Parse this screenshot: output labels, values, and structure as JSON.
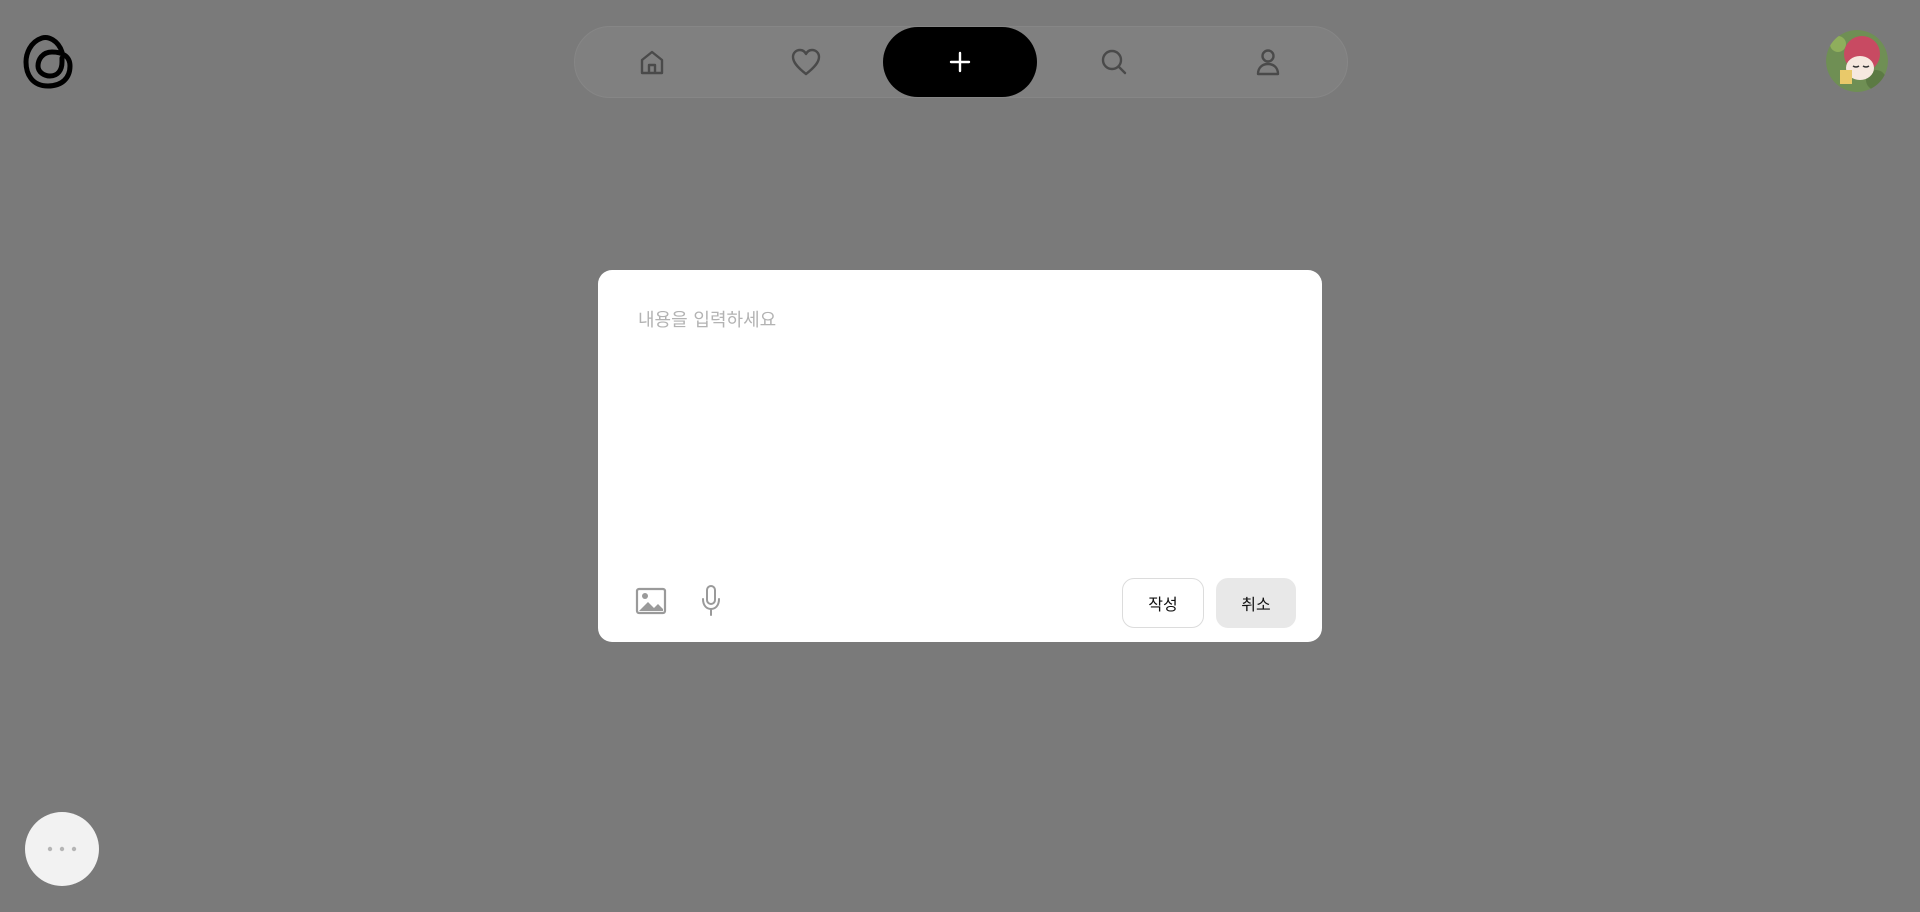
{
  "header": {
    "logo_icon": "threads-logo-icon",
    "nav": [
      {
        "id": "home",
        "icon": "home-icon"
      },
      {
        "id": "activity",
        "icon": "heart-icon"
      },
      {
        "id": "create",
        "icon": "plus-icon"
      },
      {
        "id": "search",
        "icon": "search-icon"
      },
      {
        "id": "profile",
        "icon": "person-icon"
      }
    ],
    "avatar_icon": "avatar"
  },
  "modal": {
    "placeholder": "내용을 입력하세요",
    "value": "",
    "tools": [
      "image-icon",
      "microphone-icon"
    ],
    "submit_label": "작성",
    "cancel_label": "취소"
  },
  "floating": {
    "more_icon": "more-dots-icon"
  },
  "colors": {
    "overlay": "#7a7a7a",
    "nav_bg": "#808080",
    "create_button": "#000000",
    "modal_bg": "#ffffff",
    "cancel_bg": "#e8e8e8"
  }
}
